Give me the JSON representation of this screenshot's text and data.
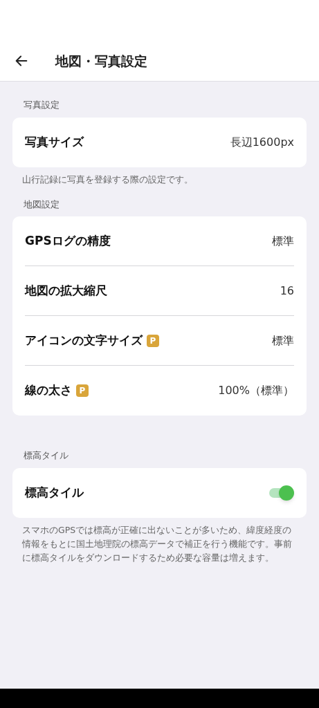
{
  "header": {
    "title": "地図・写真設定"
  },
  "sections": [
    {
      "label": "写真設定",
      "rows": [
        {
          "kind": "value",
          "label": "写真サイズ",
          "value": "長辺1600px"
        }
      ],
      "note": "山行記録に写真を登録する際の設定です。"
    },
    {
      "label": "地図設定",
      "rows": [
        {
          "kind": "value",
          "label": "GPSログの精度",
          "value": "標準"
        },
        {
          "kind": "value",
          "label": "地図の拡大縮尺",
          "value": "16"
        },
        {
          "kind": "value",
          "label": "アイコンの文字サイズ",
          "badge": "P",
          "value": "標準"
        },
        {
          "kind": "value",
          "label": "線の太さ",
          "badge": "P",
          "value": "100%（標準）"
        }
      ]
    },
    {
      "label": "標高タイル",
      "rows": [
        {
          "kind": "toggle",
          "label": "標高タイル",
          "on": true
        }
      ],
      "note": "スマホのGPSでは標高が正確に出ないことが多いため、緯度経度の情報をもとに国土地理院の標高データで補正を行う機能です。事前に標高タイルをダウンロードするため必要な容量は増えます。"
    }
  ]
}
